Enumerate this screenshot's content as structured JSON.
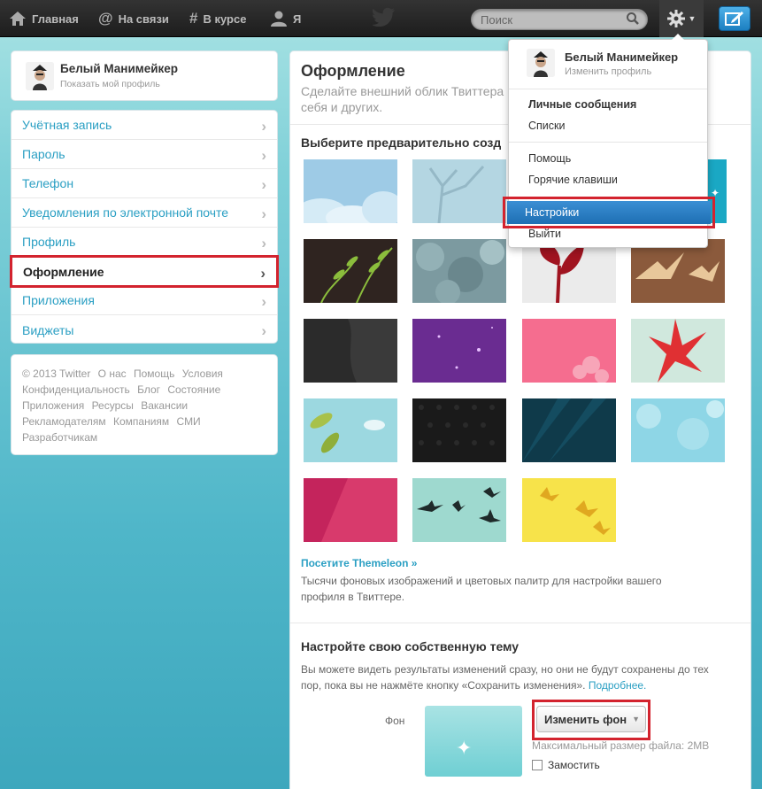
{
  "topbar": {
    "nav": [
      {
        "label": "Главная",
        "icon": "home-icon"
      },
      {
        "label": "На связи",
        "icon": "at-icon"
      },
      {
        "label": "В курсе",
        "icon": "hash-icon"
      },
      {
        "label": "Я",
        "icon": "user-icon"
      }
    ],
    "search_placeholder": "Поиск",
    "logo": "twitter-bird-icon"
  },
  "profile": {
    "name": "Белый Манимейкер",
    "link": "Показать мой профиль"
  },
  "settings_menu": [
    {
      "label": "Учётная запись"
    },
    {
      "label": "Пароль"
    },
    {
      "label": "Телефон"
    },
    {
      "label": "Уведомления по электронной почте"
    },
    {
      "label": "Профиль"
    },
    {
      "label": "Оформление",
      "active": true
    },
    {
      "label": "Приложения"
    },
    {
      "label": "Виджеты"
    }
  ],
  "footer": {
    "links": [
      "© 2013 Twitter",
      "О нас",
      "Помощь",
      "Условия",
      "Конфиденциальность",
      "Блог",
      "Состояние",
      "Приложения",
      "Ресурсы",
      "Вакансии",
      "Рекламодателям",
      "Компаниям",
      "СМИ",
      "Разработчикам"
    ]
  },
  "main": {
    "title": "Оформление",
    "subtitle": "Сделайте внешний облик Твиттера себя и других.",
    "premade_heading": "Выберите предварительно созд",
    "themeleon_link": "Посетите Themeleon »",
    "themeleon_desc": "Тысячи фоновых изображений и цветовых палитр для настройки вашего профиля в Твиттере.",
    "custom_heading": "Настройте свою собственную тему",
    "custom_desc": "Вы можете видеть результаты изменений сразу, но они не будут сохранены до тех пор, пока вы не нажмёте кнопку «Сохранить изменения».",
    "custom_more": "Подробнее.",
    "bg_label": "Фон",
    "change_bg": "Изменить фон",
    "max_size": "Максимальный размер файла: 2MB",
    "tile_label": "Замостить"
  },
  "dropdown": {
    "name": "Белый Манимейкер",
    "edit_profile": "Изменить профиль",
    "items": [
      {
        "label": "Личные сообщения",
        "bold": true
      },
      {
        "label": "Списки"
      },
      {
        "label": "Помощь"
      },
      {
        "label": "Горячие клавиши"
      },
      {
        "label": "Настройки",
        "selected": true
      },
      {
        "label": "Выйти"
      }
    ]
  },
  "colors": {
    "accent_link": "#2a9fc3",
    "highlight_red": "#d3232e",
    "selected_blue": "#1e6fb3"
  }
}
